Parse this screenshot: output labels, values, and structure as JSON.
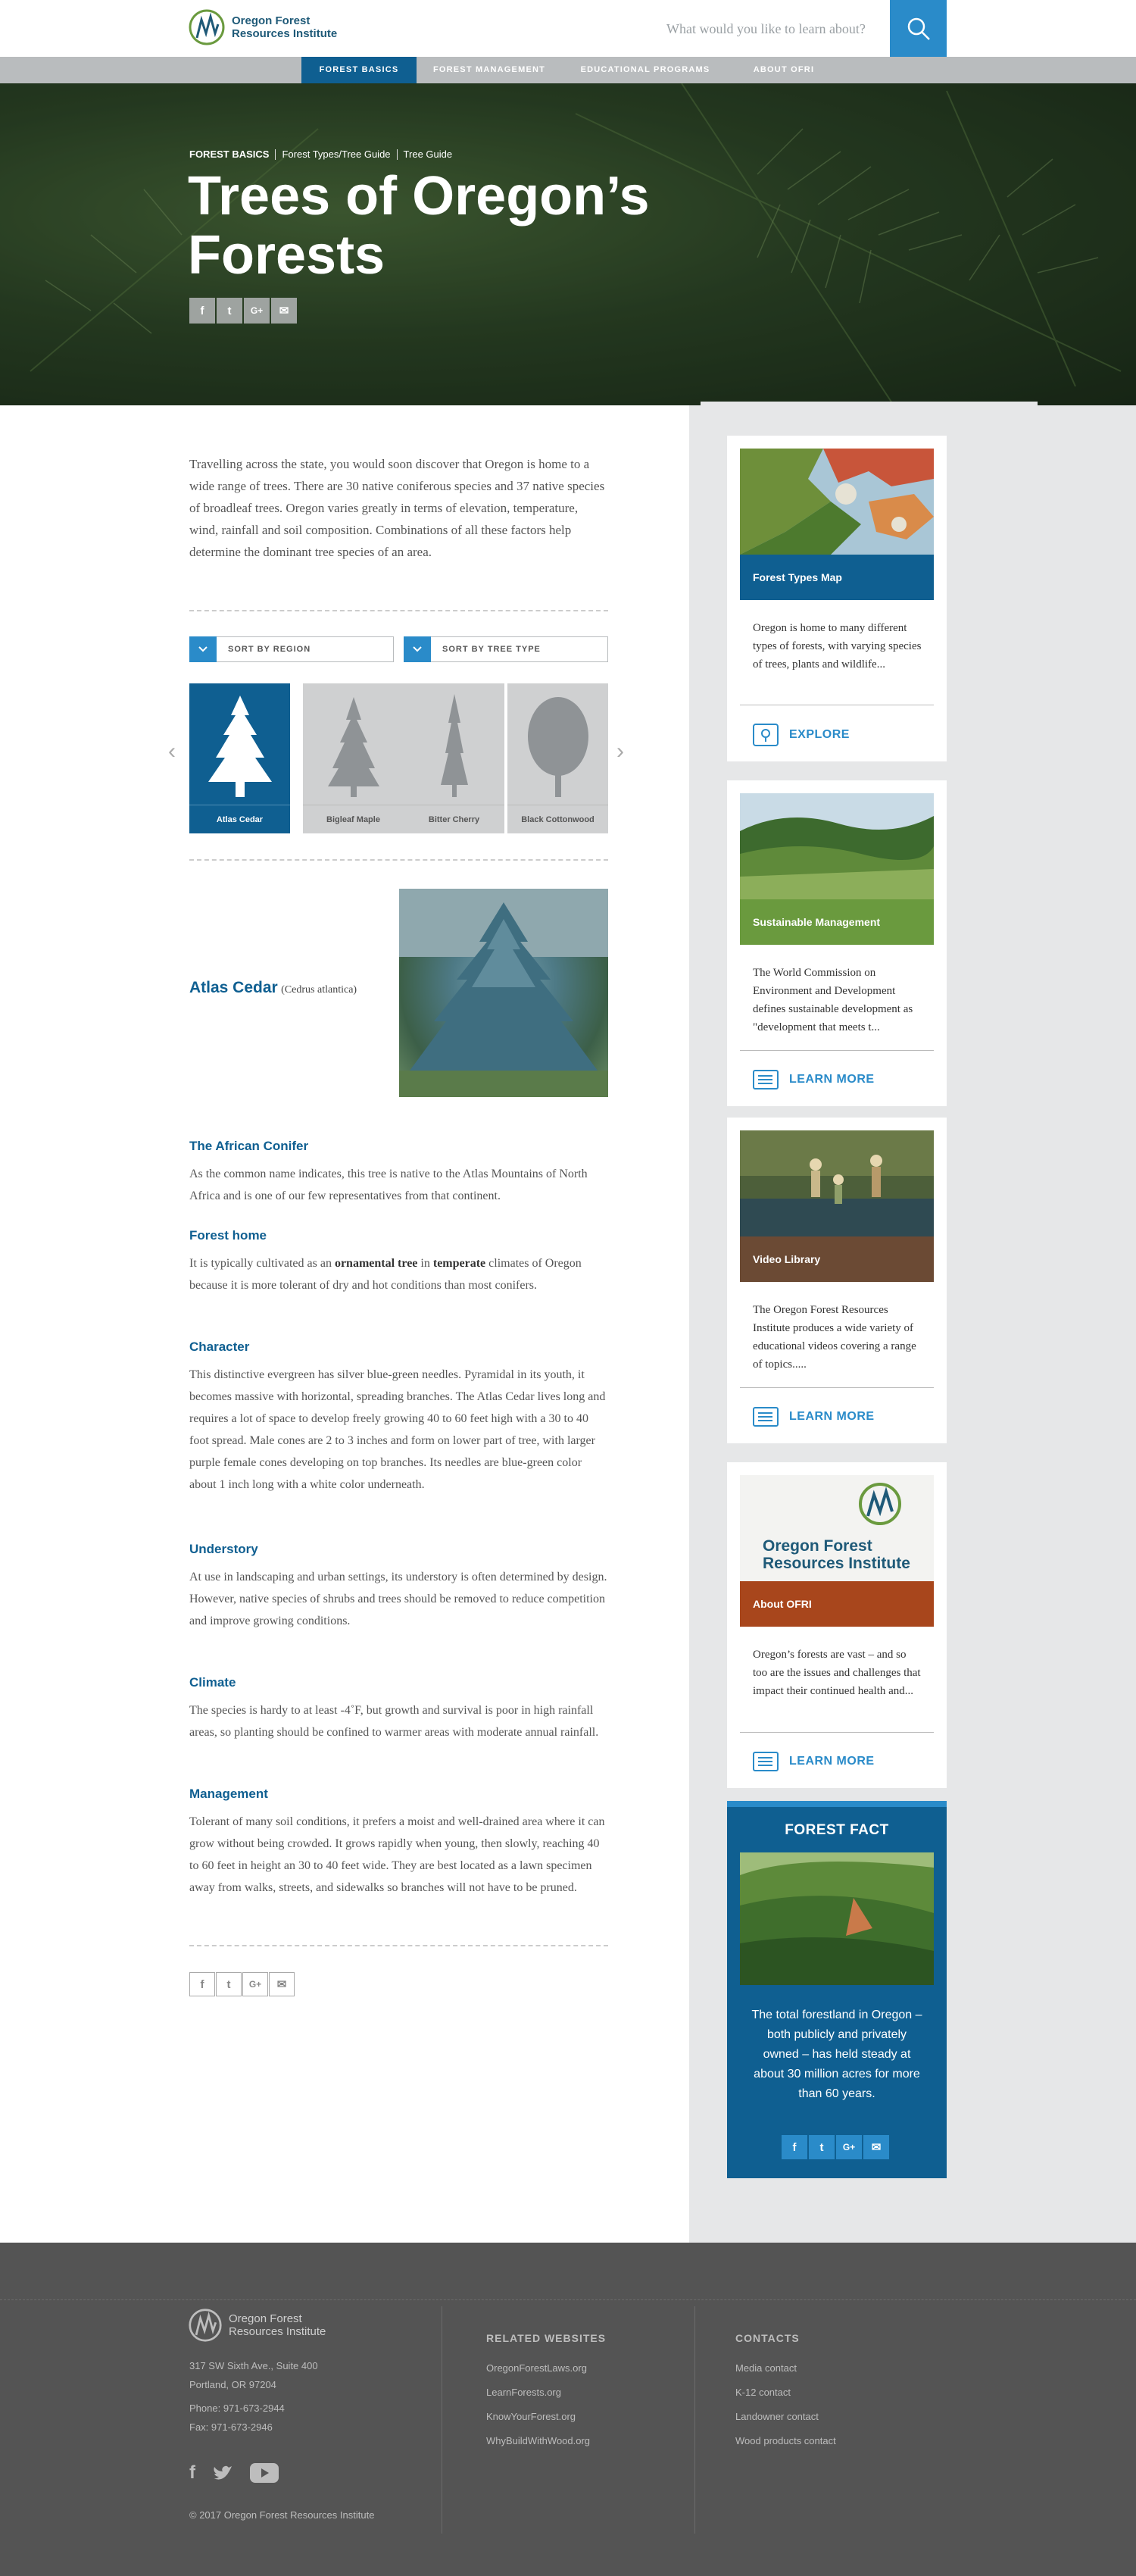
{
  "header": {
    "logo_text_1": "Oregon Forest",
    "logo_text_2": "Resources Institute",
    "search_placeholder": "What would you like to learn about?",
    "search_icon": "search-icon"
  },
  "nav": [
    "FOREST BASICS",
    "FOREST MANAGEMENT",
    "EDUCATIONAL PROGRAMS",
    "ABOUT OFRI"
  ],
  "hero": {
    "breadcrumbs": [
      "FOREST BASICS",
      "Forest Types/Tree Guide",
      "Tree Guide"
    ],
    "title_1": "Trees of Oregon’s",
    "title_2": "Forests",
    "share": [
      "f",
      "t",
      "G+",
      "✉"
    ]
  },
  "intro": "Travelling across the state, you would soon discover that Oregon is home to a wide range of trees. There are 30 native coniferous species and 37 native species of broadleaf trees. Oregon varies greatly in terms of elevation, temperature, wind, rainfall and soil composition. Combinations of all these factors help determine the dominant tree species of an area.",
  "sort": {
    "region": "SORT BY REGION",
    "type": "SORT BY TREE TYPE"
  },
  "trees": [
    "Atlas Cedar",
    "Bigleaf Maple",
    "Bitter Cherry",
    "Black Cottonwood"
  ],
  "tree": {
    "name": "Atlas Cedar",
    "scientific": "(Cedrus atlantica)"
  },
  "sections": [
    {
      "heading": "The African Conifer",
      "body": "As the common name indicates, this tree is native to the Atlas Mountains of North Africa and is one of our few representatives from that continent."
    },
    {
      "heading": "Forest home",
      "body_pre": "It is typically cultivated as an ",
      "body_b1": "ornamental tree",
      "body_mid": " in ",
      "body_b2": "temperate",
      "body_post": " climates of Oregon because it is more tolerant of dry and hot conditions than most conifers."
    },
    {
      "heading": "Character",
      "body": "This distinctive evergreen has silver blue-green needles. Pyramidal in its youth, it becomes massive with horizontal, spreading branches. The Atlas Cedar lives long and requires a lot of space to develop freely growing 40 to 60 feet high with a 30 to 40 foot spread. Male cones are 2 to 3 inches and form on lower part of tree, with larger purple female cones developing on top branches. Its needles are blue-green color about 1 inch long with a white color underneath."
    },
    {
      "heading": "Understory",
      "body": "At use in landscaping and urban settings, its understory is often determined by design.  However, native species of shrubs and trees should be removed to reduce competition and improve growing conditions."
    },
    {
      "heading": "Climate",
      "body": "The species is hardy to at least -4˚F, but growth and survival is poor in high rainfall areas, so planting should be confined to warmer areas with moderate annual rainfall."
    },
    {
      "heading": "Management",
      "body": "Tolerant of many soil conditions, it prefers a moist and well-drained area where it can grow without being crowded. It grows rapidly when young, then slowly, reaching 40 to 60 feet in height an 30 to 40 feet wide. They are best located as a lawn specimen away from walks, streets, and sidewalks so branches will not have to be pruned."
    }
  ],
  "sidebar": {
    "cards": [
      {
        "title": "Forest Types Map",
        "desc": "Oregon is home to many different types of forests, with varying species of trees, plants and wildlife...",
        "cta": "EXPLORE",
        "color": "#0f5f91"
      },
      {
        "title": "Sustainable Management",
        "desc": "The World Commission on Environment and Development defines sustainable development as \"development that meets t...",
        "cta": "LEARN MORE",
        "color": "#6a9a3e"
      },
      {
        "title": "Video Library",
        "desc": "The Oregon Forest Resources Institute produces a wide variety of educational videos covering a range of topics.....",
        "cta": "LEARN MORE",
        "color": "#6b4a34"
      },
      {
        "title": "About OFRI",
        "desc": "Oregon’s forests are vast – and so too are the issues and challenges that impact their continued health and...",
        "cta": "LEARN MORE",
        "color": "#a8461c"
      }
    ],
    "about_logo_1": "Oregon Forest",
    "about_logo_2": "Resources Institute",
    "fact_title": "FOREST FACT",
    "fact_text": "The total forestland in Oregon – both publicly and privately owned – has held steady at about 30 million acres for more than 60 years."
  },
  "footer": {
    "logo_1": "Oregon Forest",
    "logo_2": "Resources Institute",
    "address_1": "317 SW Sixth Ave., Suite 400",
    "address_2": "Portland, OR 97204",
    "phone": "Phone: 971-673-2944",
    "fax": "Fax: 971-673-2946",
    "copyright": "© 2017 Oregon Forest Resources Institute",
    "related_heading": "RELATED WEBSITES",
    "related": [
      "OregonForestLaws.org",
      "LearnForests.org",
      "KnowYourForest.org",
      "WhyBuildWithWood.org"
    ],
    "contacts_heading": "CONTACTS",
    "contacts": [
      "Media contact",
      "K-12 contact",
      "Landowner contact",
      "Wood products contact"
    ]
  },
  "colors": {
    "brand_blue": "#0f5f91",
    "accent_blue": "#2a8bc9",
    "footer_bg": "#545454"
  }
}
